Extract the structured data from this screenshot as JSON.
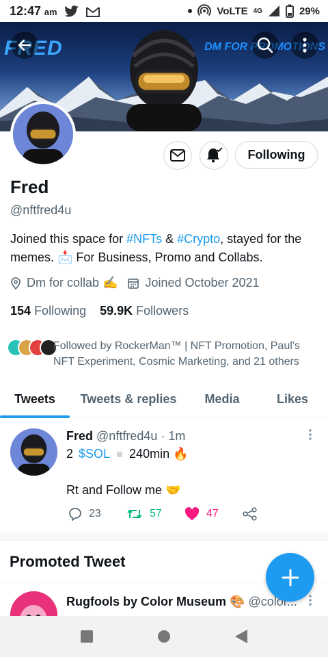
{
  "status_bar": {
    "time": "12:47",
    "ampm": "am",
    "network": "VoLTE",
    "signal_label": "4G",
    "battery": "29%",
    "icons": [
      "twitter-icon",
      "gmail-icon",
      "dot-icon",
      "hotspot-icon",
      "signal-icon",
      "battery-icon"
    ]
  },
  "banner": {
    "left_text": "FRED",
    "right_text": "DM FOR PROMOTIONS"
  },
  "profile": {
    "name": "Fred",
    "handle": "@nftfred4u",
    "bio_parts": [
      "Joined this space for ",
      "#NFTs",
      " & ",
      "#Crypto",
      ", stayed for the memes. 📩 For Business, Promo and Collabs."
    ],
    "location": "Dm for collab ✍",
    "joined": "Joined October 2021",
    "following_count": "154",
    "following_label": "Following",
    "followers_count": "59.9K",
    "followers_label": "Followers",
    "followed_by": "Followed by RockerMan™ | NFT Promotion, Paul's NFT Experiment, Cosmic Marketing, and 21 others",
    "follow_button_label": "Following"
  },
  "tabs": [
    {
      "label": "Tweets",
      "active": true
    },
    {
      "label": "Tweets & replies",
      "active": false
    },
    {
      "label": "Media",
      "active": false
    },
    {
      "label": "Likes",
      "active": false
    }
  ],
  "tweet": {
    "name": "Fred",
    "handle_time": "@nftfred4u · 1m",
    "line1_prefix": "2",
    "cashtag": "$SOL",
    "line1_suffix": "240min 🔥",
    "line2": "Rt and Follow me 🤝",
    "replies": "23",
    "retweets": "57",
    "likes": "47"
  },
  "promoted": {
    "title": "Promoted Tweet",
    "name": "Rugfools by Color Museum 🎨",
    "handle": "@color..."
  },
  "colors": {
    "accent": "#1d9bf0",
    "retweet": "#00ba7c",
    "like": "#f91880",
    "secondary_text": "#536471"
  }
}
